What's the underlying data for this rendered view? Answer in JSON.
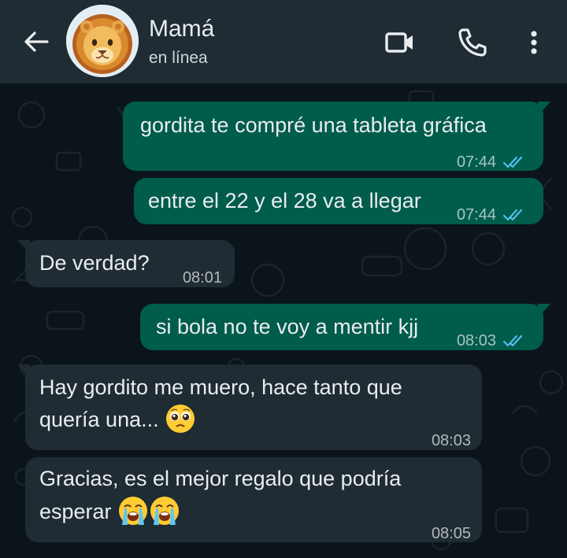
{
  "header": {
    "contact_name": "Mamá",
    "status": "en línea"
  },
  "messages": [
    {
      "direction": "out",
      "text": "gordita te compré una tableta gráfica",
      "time": "07:44",
      "ticks": "read"
    },
    {
      "direction": "out",
      "text": "entre el 22 y el 28 va a llegar",
      "time": "07:44",
      "ticks": "read"
    },
    {
      "direction": "in",
      "text": "De verdad?",
      "time": "08:01"
    },
    {
      "direction": "out",
      "text": "si bola no te voy a mentir kjj",
      "time": "08:03",
      "ticks": "read"
    },
    {
      "direction": "in",
      "line1": "Hay gordito me muero, hace tanto que",
      "line2": "quería una...",
      "time": "08:03"
    },
    {
      "direction": "in",
      "line1": "Gracias, es el mejor regalo que podría",
      "line2": "esperar",
      "time": "08:05"
    }
  ],
  "icons": {
    "back": "arrow-left-icon",
    "video": "video-camera-icon",
    "call": "phone-icon",
    "menu": "more-vertical-icon",
    "read_receipt": "double-check-icon"
  },
  "colors": {
    "header_bg": "#1f2c34",
    "chat_bg": "#0b141a",
    "outgoing_bubble": "#005c4b",
    "incoming_bubble": "#202c33",
    "read_tick": "#53bdeb"
  }
}
